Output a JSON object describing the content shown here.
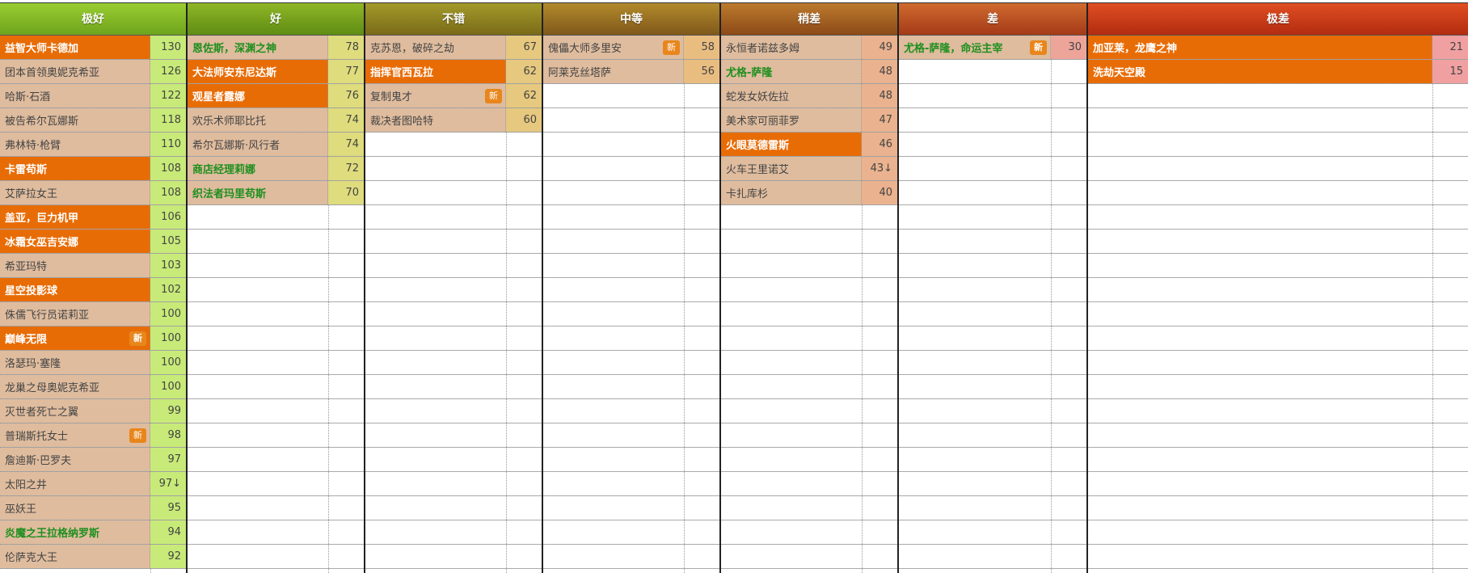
{
  "colors": {
    "header_gradients": [
      [
        "#9acd32",
        "#6ea41c"
      ],
      [
        "#8fb626",
        "#5f8d14"
      ],
      [
        "#a39a2a",
        "#7a6a18"
      ],
      [
        "#b28a2c",
        "#80581a"
      ],
      [
        "#bd7a2e",
        "#8c4a18"
      ],
      [
        "#cf6a2e",
        "#a53a18"
      ],
      [
        "#e04e22",
        "#b22c10"
      ]
    ],
    "score_bg": [
      "#c8ea78",
      "#dedc7c",
      "#e6c87e",
      "#e9bd80",
      "#eab28e",
      "#eda59a",
      "#f0a0a0"
    ],
    "highlight": "#e86c06",
    "name_bg": "#dfbc9e",
    "green_text": "#1f8f1f"
  },
  "tiers": [
    {
      "title": "极好",
      "items": [
        {
          "name": "益智大师卡德加",
          "score": "130",
          "hi": true
        },
        {
          "name": "团本首领奥妮克希亚",
          "score": "126"
        },
        {
          "name": "哈斯·石酒",
          "score": "122"
        },
        {
          "name": "被告希尔瓦娜斯",
          "score": "118"
        },
        {
          "name": "弗林特·枪臂",
          "score": "110"
        },
        {
          "name": "卡雷苟斯",
          "score": "108",
          "hi": true
        },
        {
          "name": "艾萨拉女王",
          "score": "108"
        },
        {
          "name": "盖亚，巨力机甲",
          "score": "106",
          "hi": true
        },
        {
          "name": "冰霜女巫吉安娜",
          "score": "105",
          "hi": true
        },
        {
          "name": "希亚玛特",
          "score": "103"
        },
        {
          "name": "星空投影球",
          "score": "102",
          "hi": true
        },
        {
          "name": "侏儒飞行员诺莉亚",
          "score": "100"
        },
        {
          "name": "巅峰无限",
          "score": "100",
          "hi": true,
          "badge": "新"
        },
        {
          "name": "洛瑟玛·塞隆",
          "score": "100"
        },
        {
          "name": "龙巢之母奥妮克希亚",
          "score": "100"
        },
        {
          "name": "灭世者死亡之翼",
          "score": "99"
        },
        {
          "name": "普瑞斯托女士",
          "score": "98",
          "badge": "新"
        },
        {
          "name": "詹迪斯·巴罗夫",
          "score": "97"
        },
        {
          "name": "太阳之井",
          "score": "97↓"
        },
        {
          "name": "巫妖王",
          "score": "95"
        },
        {
          "name": "炎魔之王拉格纳罗斯",
          "score": "94",
          "green": true
        },
        {
          "name": "伦萨克大王",
          "score": "92"
        }
      ]
    },
    {
      "title": "好",
      "items": [
        {
          "name": "恩佐斯，深渊之神",
          "score": "78",
          "green": true
        },
        {
          "name": "大法师安东尼达斯",
          "score": "77",
          "hi": true
        },
        {
          "name": "观星者露娜",
          "score": "76",
          "hi": true
        },
        {
          "name": "欢乐术师耶比托",
          "score": "74"
        },
        {
          "name": "希尔瓦娜斯·风行者",
          "score": "74"
        },
        {
          "name": "商店经理莉娜",
          "score": "72",
          "green": true
        },
        {
          "name": "织法者玛里苟斯",
          "score": "70",
          "green": true
        }
      ]
    },
    {
      "title": "不错",
      "items": [
        {
          "name": "克苏恩，破碎之劫",
          "score": "67"
        },
        {
          "name": "指挥官西瓦拉",
          "score": "62",
          "hi": true
        },
        {
          "name": "复制鬼才",
          "score": "62",
          "badge": "新"
        },
        {
          "name": "裁决者图哈特",
          "score": "60"
        }
      ]
    },
    {
      "title": "中等",
      "items": [
        {
          "name": "傀儡大师多里安",
          "score": "58",
          "badge": "新"
        },
        {
          "name": "阿莱克丝塔萨",
          "score": "56"
        }
      ]
    },
    {
      "title": "稍差",
      "items": [
        {
          "name": "永恒者诺兹多姆",
          "score": "49"
        },
        {
          "name": "尤格-萨隆",
          "score": "48",
          "green": true
        },
        {
          "name": "蛇发女妖佐拉",
          "score": "48"
        },
        {
          "name": "美术家可丽菲罗",
          "score": "47"
        },
        {
          "name": "火眼莫德雷斯",
          "score": "46",
          "hi": true
        },
        {
          "name": "火车王里诺艾",
          "score": "43↓"
        },
        {
          "name": "卡扎库杉",
          "score": "40"
        }
      ]
    },
    {
      "title": "差",
      "items": [
        {
          "name": "尤格-萨隆，命运主宰",
          "score": "30",
          "green": true,
          "badge": "新"
        }
      ]
    },
    {
      "title": "极差",
      "items": [
        {
          "name": "加亚莱，龙鹰之神",
          "score": "21",
          "hi": true
        },
        {
          "name": "洗劫天空殿",
          "score": "15",
          "hi": true
        }
      ]
    }
  ]
}
